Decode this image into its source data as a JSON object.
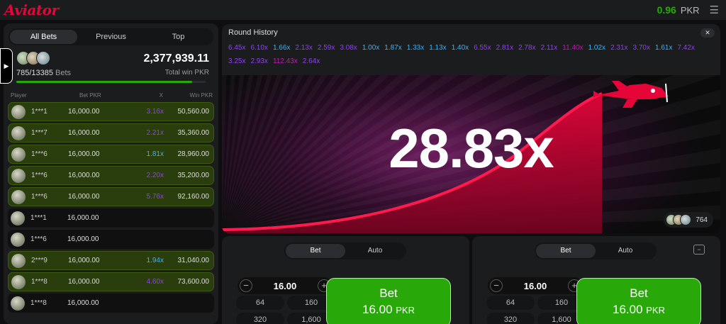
{
  "header": {
    "logo": "Aviator",
    "balance": "0.96",
    "currency": "PKR"
  },
  "left_panel": {
    "tabs": [
      {
        "label": "All Bets",
        "active": true
      },
      {
        "label": "Previous",
        "active": false
      },
      {
        "label": "Top",
        "active": false
      }
    ],
    "bets_count": "785/13385",
    "bets_label": "Bets",
    "total_win": "2,377,939.11",
    "total_win_label": "Total win PKR",
    "progress_fraction": 0.93,
    "columns": {
      "player": "Player",
      "bet": "Bet PKR",
      "x": "X",
      "win": "Win PKR"
    },
    "rows": [
      {
        "player": "1***1",
        "bet": "16,000.00",
        "x": "3.16x",
        "win": "50,560.00",
        "color": "#913ef8"
      },
      {
        "player": "1***7",
        "bet": "16,000.00",
        "x": "2.21x",
        "win": "35,360.00",
        "color": "#913ef8"
      },
      {
        "player": "1***6",
        "bet": "16,000.00",
        "x": "1.81x",
        "win": "28,960.00",
        "color": "#34b4ff"
      },
      {
        "player": "1***6",
        "bet": "16,000.00",
        "x": "2.20x",
        "win": "35,200.00",
        "color": "#913ef8"
      },
      {
        "player": "1***6",
        "bet": "16,000.00",
        "x": "5.76x",
        "win": "92,160.00",
        "color": "#913ef8"
      },
      {
        "player": "1***1",
        "bet": "16,000.00",
        "x": "",
        "win": "",
        "color": ""
      },
      {
        "player": "1***6",
        "bet": "16,000.00",
        "x": "",
        "win": "",
        "color": ""
      },
      {
        "player": "2***9",
        "bet": "16,000.00",
        "x": "1.94x",
        "win": "31,040.00",
        "color": "#34b4ff"
      },
      {
        "player": "1***8",
        "bet": "16,000.00",
        "x": "4.60x",
        "win": "73,600.00",
        "color": "#913ef8"
      },
      {
        "player": "1***8",
        "bet": "16,000.00",
        "x": "",
        "win": "",
        "color": ""
      }
    ]
  },
  "round_history": {
    "title": "Round History",
    "close": "✕",
    "items": [
      {
        "v": "6.45x",
        "c": "#913ef8"
      },
      {
        "v": "6.10x",
        "c": "#913ef8"
      },
      {
        "v": "1.66x",
        "c": "#34b4ff"
      },
      {
        "v": "2.13x",
        "c": "#913ef8"
      },
      {
        "v": "2.59x",
        "c": "#913ef8"
      },
      {
        "v": "3.08x",
        "c": "#913ef8"
      },
      {
        "v": "1.00x",
        "c": "#34b4ff"
      },
      {
        "v": "1.87x",
        "c": "#34b4ff"
      },
      {
        "v": "1.33x",
        "c": "#34b4ff"
      },
      {
        "v": "1.13x",
        "c": "#34b4ff"
      },
      {
        "v": "1.40x",
        "c": "#34b4ff"
      },
      {
        "v": "6.55x",
        "c": "#913ef8"
      },
      {
        "v": "2.81x",
        "c": "#913ef8"
      },
      {
        "v": "2.78x",
        "c": "#913ef8"
      },
      {
        "v": "2.11x",
        "c": "#913ef8"
      },
      {
        "v": "11.40x",
        "c": "#c017b4"
      },
      {
        "v": "1.02x",
        "c": "#34b4ff"
      },
      {
        "v": "2.31x",
        "c": "#913ef8"
      },
      {
        "v": "3.70x",
        "c": "#913ef8"
      },
      {
        "v": "1.61x",
        "c": "#34b4ff"
      },
      {
        "v": "7.42x",
        "c": "#913ef8"
      },
      {
        "v": "3.25x",
        "c": "#913ef8"
      },
      {
        "v": "2.93x",
        "c": "#913ef8"
      },
      {
        "v": "112.43x",
        "c": "#c017b4"
      },
      {
        "v": "2.64x",
        "c": "#913ef8"
      }
    ]
  },
  "game": {
    "multiplier": "28.83x",
    "online_count": "764",
    "accent": "#e50539"
  },
  "bet_panels": [
    {
      "tabs": [
        "Bet",
        "Auto"
      ],
      "stake": "16.00",
      "minus": "−",
      "plus": "+",
      "quick": [
        "64",
        "160",
        "320",
        "1,600"
      ],
      "button_label": "Bet",
      "button_amount": "16.00",
      "button_currency": "PKR"
    },
    {
      "tabs": [
        "Bet",
        "Auto"
      ],
      "stake": "16.00",
      "minus": "−",
      "plus": "+",
      "quick": [
        "64",
        "160",
        "320",
        "1,600"
      ],
      "button_label": "Bet",
      "button_amount": "16.00",
      "button_currency": "PKR",
      "extra": "−"
    }
  ]
}
